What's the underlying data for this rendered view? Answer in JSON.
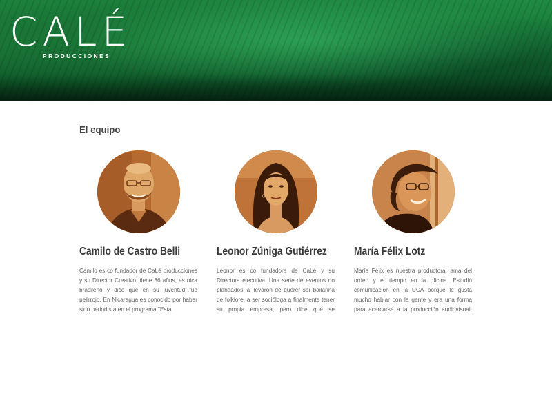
{
  "header": {
    "logo_text": "CALÉ",
    "logo_subtitle": "PRODUCCIONES"
  },
  "team": {
    "title": "El equipo",
    "members": [
      {
        "name": "Camilo de Castro Belli",
        "bio": "Camilo es co fundador de CaLé producciones y su Director Creativo, tiene 36 años, es nica brasileño y dice que en su juventud fue pelirrojo. En Nicaragua es conocido por haber sido periodista en el programa \"Esta",
        "photo_icon": "man-portrait-photo"
      },
      {
        "name": "Leonor Zúniga Gutiérrez",
        "bio": "Leonor es co fundadora de CaLé y su Directora ejecutiva. Una serie de eventos no planeados la llevaron de querer ser bailarina de folklore, a ser socióloga a finalmente tener su propia empresa, pero dice que se encuentra muy satisfecha",
        "photo_icon": "woman-portrait-photo"
      },
      {
        "name": "María Félix Lotz",
        "bio": "María Félix es nuestra productora, ama del orden y el tiempo en la oficina. Estudió comunicación en la UCA porque le gusta mucho hablar con la gente y era una forma para acercarse a la producción audiovisual, pues es una apasionada",
        "photo_icon": "woman-glasses-portrait-photo"
      }
    ]
  },
  "colors": {
    "header_green": "#1a7a3a",
    "photo_tone": "#b4642a",
    "text_dark": "#3a3a3a",
    "text_body": "#666666"
  }
}
